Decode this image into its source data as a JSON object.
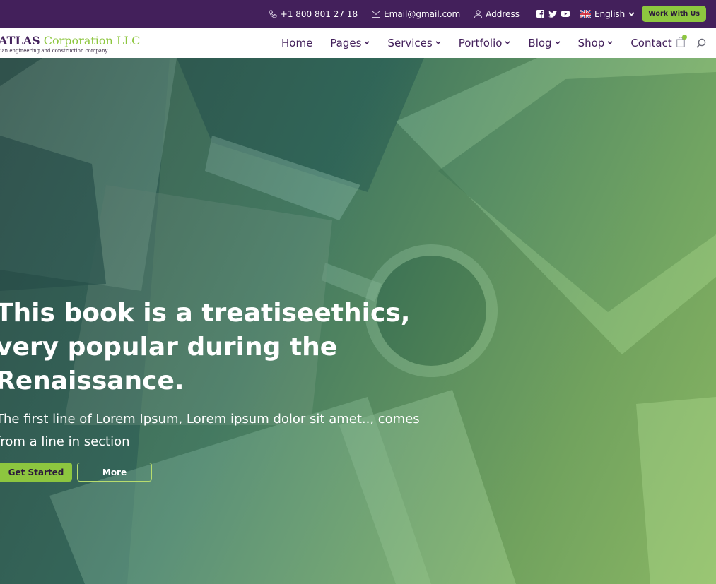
{
  "topbar": {
    "phone": "+1 800 801 27 18",
    "email": "Email@gmail.com",
    "address": "Address",
    "language": "English",
    "work_button": "Work With Us",
    "social_icons": [
      "facebook-icon",
      "twitter-icon",
      "youtube-icon"
    ],
    "background": "#43205b"
  },
  "logo": {
    "name_bold": "ATLAS",
    "name_rest": "Corporation LLC",
    "tagline": "lian engineering and construction company"
  },
  "nav": {
    "items": [
      {
        "label": "Home",
        "dropdown": false
      },
      {
        "label": "Pages",
        "dropdown": true
      },
      {
        "label": "Services",
        "dropdown": true
      },
      {
        "label": "Portfolio",
        "dropdown": true
      },
      {
        "label": "Blog",
        "dropdown": true
      },
      {
        "label": "Shop",
        "dropdown": true
      },
      {
        "label": "Contact",
        "dropdown": false
      }
    ],
    "icons": [
      "cart-icon",
      "search-icon"
    ]
  },
  "hero": {
    "title": "This book is a treatiseethics, very popular during the Renaissance.",
    "text": "The first line of Lorem Ipsum, Lorem ipsum dolor sit amet.., comes from a line in section",
    "primary_button": "Get Started",
    "secondary_button": "More"
  },
  "colors": {
    "brand_purple": "#43205b",
    "brand_green": "#8dc63f"
  }
}
